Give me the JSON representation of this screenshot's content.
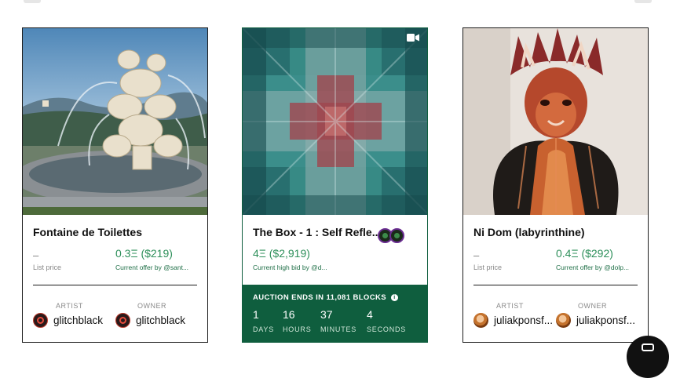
{
  "cards": [
    {
      "title": "Fontaine de Toilettes",
      "dash": "–",
      "price": "0.3Ξ ($219)",
      "price_note": "List price",
      "offer": "Current offer by @sant...",
      "artist_label": "ARTIST",
      "owner_label": "OWNER",
      "artist": "glitchblack",
      "owner": "glitchblack"
    },
    {
      "title": "The Box - 1 : Self Refle...",
      "price": "4Ξ ($2,919)",
      "bid_note": "Current high bid by @d...",
      "auction": {
        "title": "AUCTION ENDS IN 11,081 BLOCKS",
        "days": "1",
        "days_label": "DAYS",
        "hours": "16",
        "hours_label": "HOURS",
        "minutes": "37",
        "minutes_label": "MINUTES",
        "seconds": "4",
        "seconds_label": "SECONDS"
      }
    },
    {
      "title": "Ni Dom (labyrinthine)",
      "dash": "–",
      "price": "0.4Ξ ($292)",
      "price_note": "List price",
      "offer": "Current offer by @dolp...",
      "artist_label": "ARTIST",
      "owner_label": "OWNER",
      "artist": "juliakponsf...",
      "owner": "juliakponsf..."
    }
  ],
  "icons": {
    "video": "video-camera-icon",
    "info": "info-icon",
    "chat": "chat-bubble-icon"
  },
  "colors": {
    "accent_green": "#2d8f5a",
    "auction_bg": "#0f5e3e"
  }
}
